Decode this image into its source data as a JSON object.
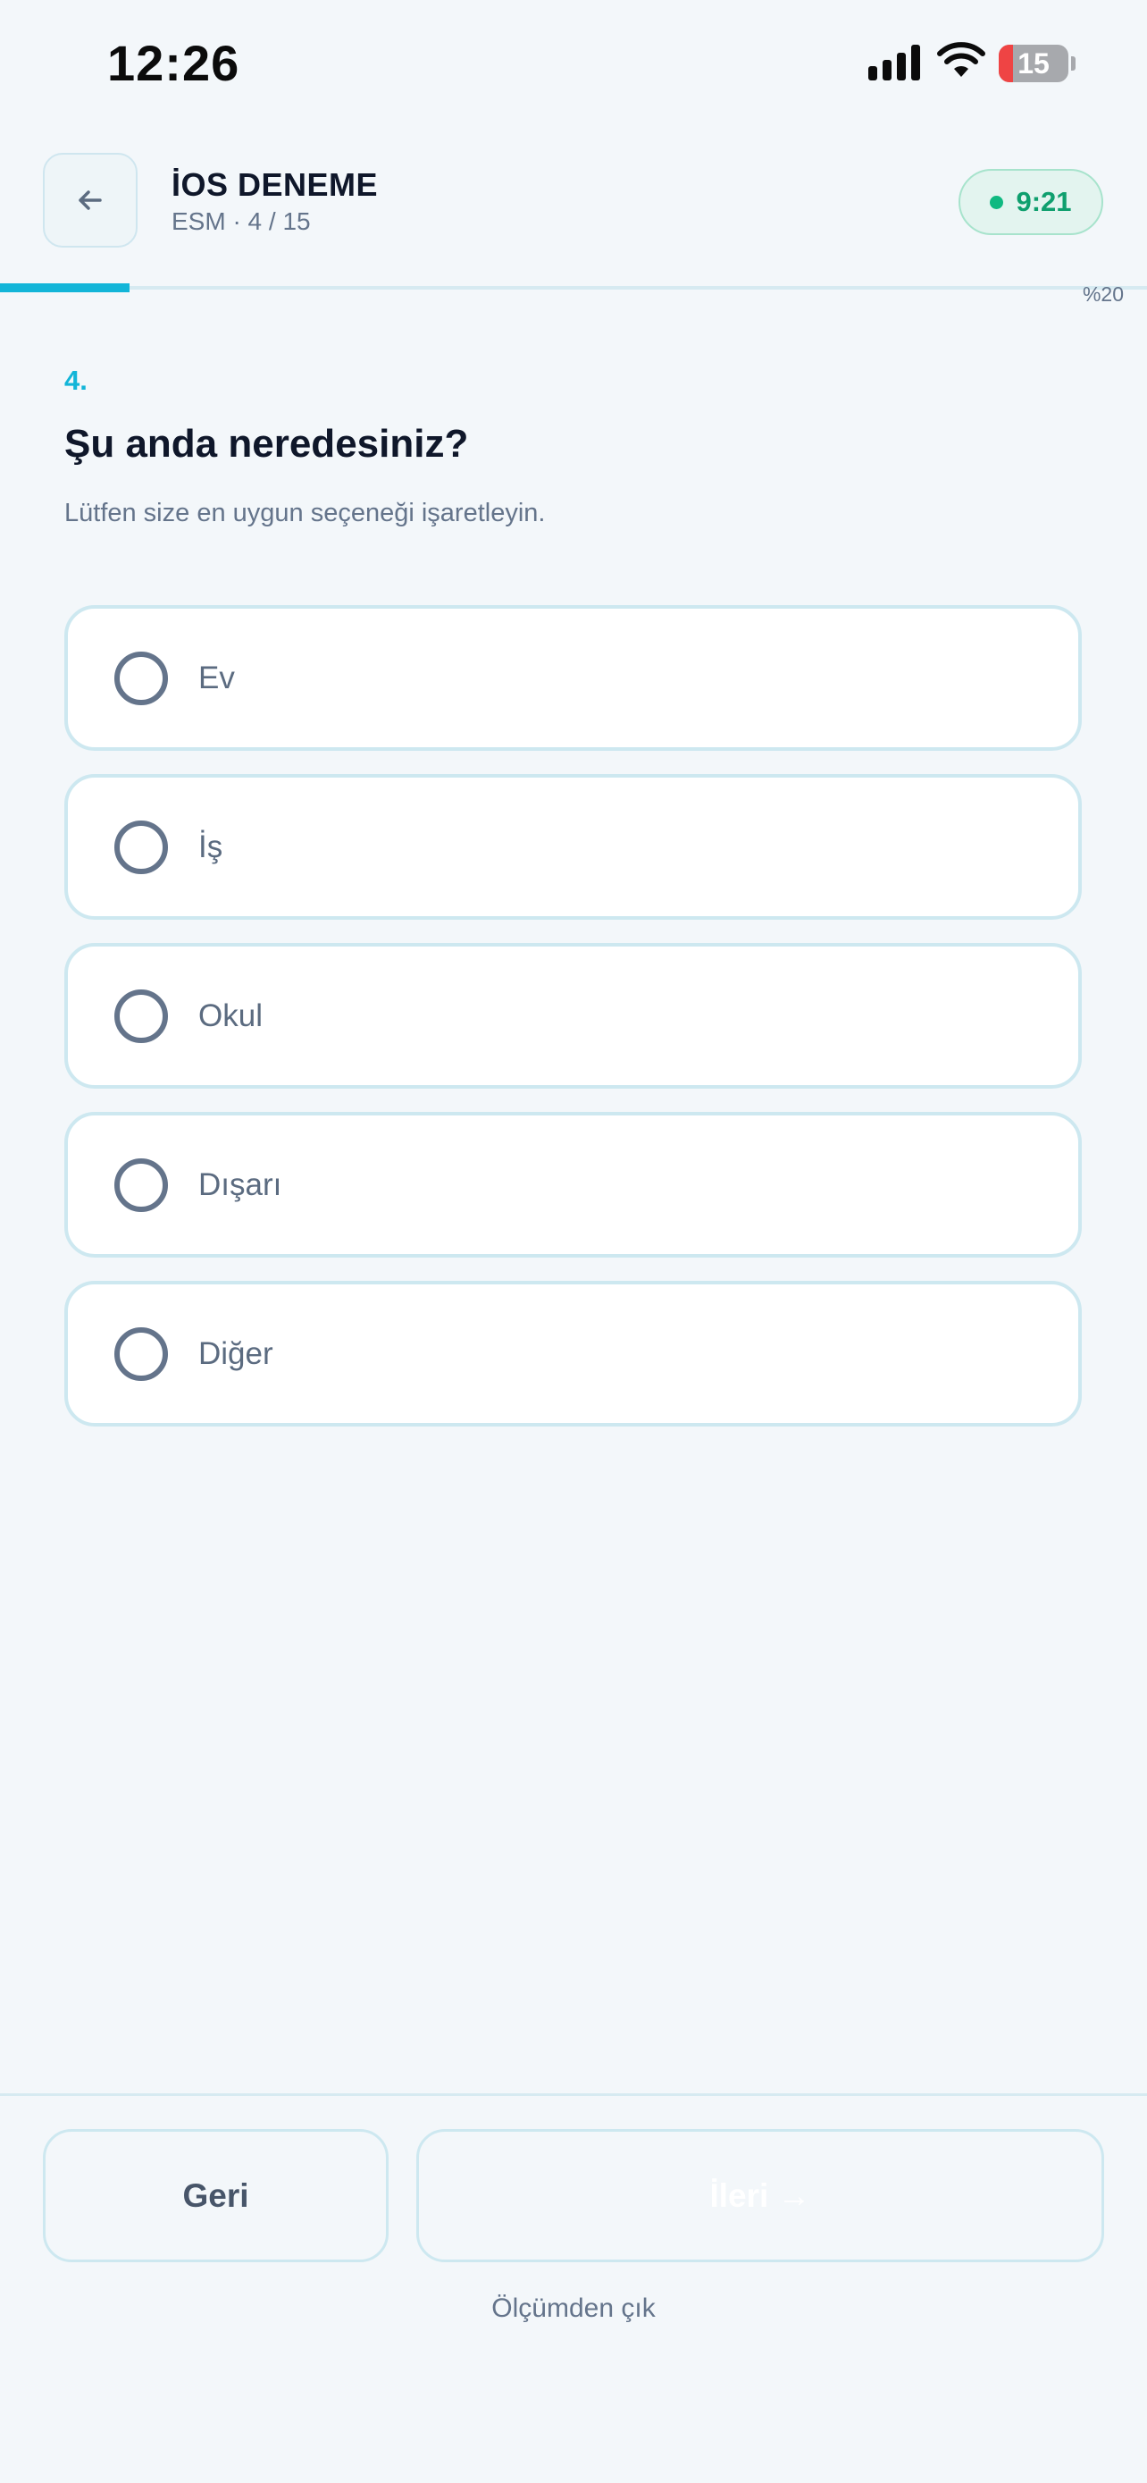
{
  "status_bar": {
    "time": "12:26",
    "battery": "15"
  },
  "header": {
    "title": "İOS DENEME",
    "subtitle": "ESM · 4 / 15",
    "timer": "9:21",
    "timer_color": "#10b981"
  },
  "progress": {
    "label": "%20",
    "value_percent": 20,
    "color": "#12b5d8"
  },
  "question": {
    "number": "4.",
    "text": "Şu anda neredesiniz?",
    "hint": "Lütfen size en uygun seçeneği işaretleyin."
  },
  "options": [
    {
      "label": "Ev"
    },
    {
      "label": "İş"
    },
    {
      "label": "Okul"
    },
    {
      "label": "Dışarı"
    },
    {
      "label": "Diğer"
    }
  ],
  "footer": {
    "prev_label": "Geri",
    "next_label": "İleri →",
    "exit_label": "Ölçümden çık"
  },
  "icons": {
    "back": "arrow-left-icon",
    "signal": "cellular-signal-icon",
    "wifi": "wifi-icon",
    "battery": "battery-icon"
  }
}
